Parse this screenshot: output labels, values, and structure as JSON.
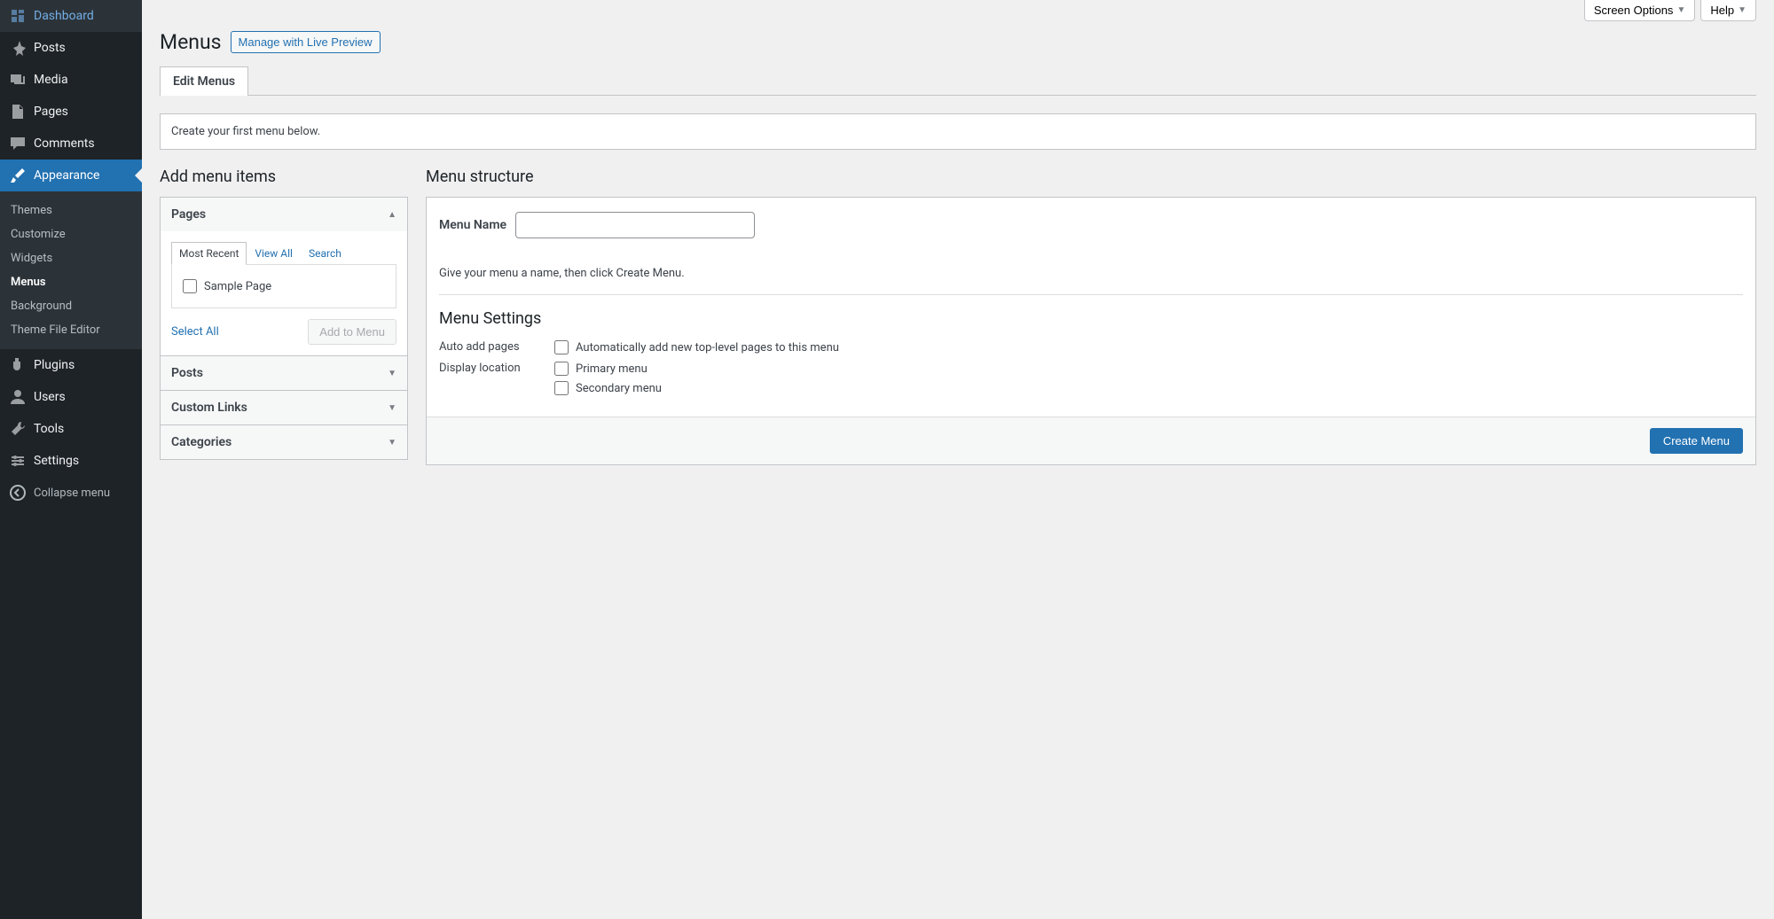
{
  "sidebar": {
    "items": [
      {
        "label": "Dashboard",
        "icon": "dashboard"
      },
      {
        "label": "Posts",
        "icon": "pin"
      },
      {
        "label": "Media",
        "icon": "media"
      },
      {
        "label": "Pages",
        "icon": "page"
      },
      {
        "label": "Comments",
        "icon": "comment"
      },
      {
        "label": "Appearance",
        "icon": "brush",
        "active": true
      },
      {
        "label": "Plugins",
        "icon": "plug"
      },
      {
        "label": "Users",
        "icon": "user"
      },
      {
        "label": "Tools",
        "icon": "tools"
      },
      {
        "label": "Settings",
        "icon": "settings"
      }
    ],
    "submenu": [
      "Themes",
      "Customize",
      "Widgets",
      "Menus",
      "Background",
      "Theme File Editor"
    ],
    "submenu_current": "Menus",
    "collapse": "Collapse menu"
  },
  "top_buttons": {
    "screen_options": "Screen Options",
    "help": "Help"
  },
  "header": {
    "title": "Menus",
    "live_preview": "Manage with Live Preview"
  },
  "tabs": {
    "edit": "Edit Menus"
  },
  "notice": "Create your first menu below.",
  "left": {
    "heading": "Add menu items",
    "sections": [
      {
        "title": "Pages",
        "expanded": true
      },
      {
        "title": "Posts",
        "expanded": false
      },
      {
        "title": "Custom Links",
        "expanded": false
      },
      {
        "title": "Categories",
        "expanded": false
      }
    ],
    "pages_tabs": [
      "Most Recent",
      "View All",
      "Search"
    ],
    "pages_items": [
      "Sample Page"
    ],
    "select_all": "Select All",
    "add_to_menu": "Add to Menu"
  },
  "right": {
    "heading": "Menu structure",
    "menu_name_label": "Menu Name",
    "menu_name_value": "",
    "instruction": "Give your menu a name, then click Create Menu.",
    "settings_heading": "Menu Settings",
    "auto_add_label": "Auto add pages",
    "auto_add_option": "Automatically add new top-level pages to this menu",
    "display_label": "Display location",
    "display_options": [
      "Primary menu",
      "Secondary menu"
    ],
    "create_menu": "Create Menu"
  }
}
